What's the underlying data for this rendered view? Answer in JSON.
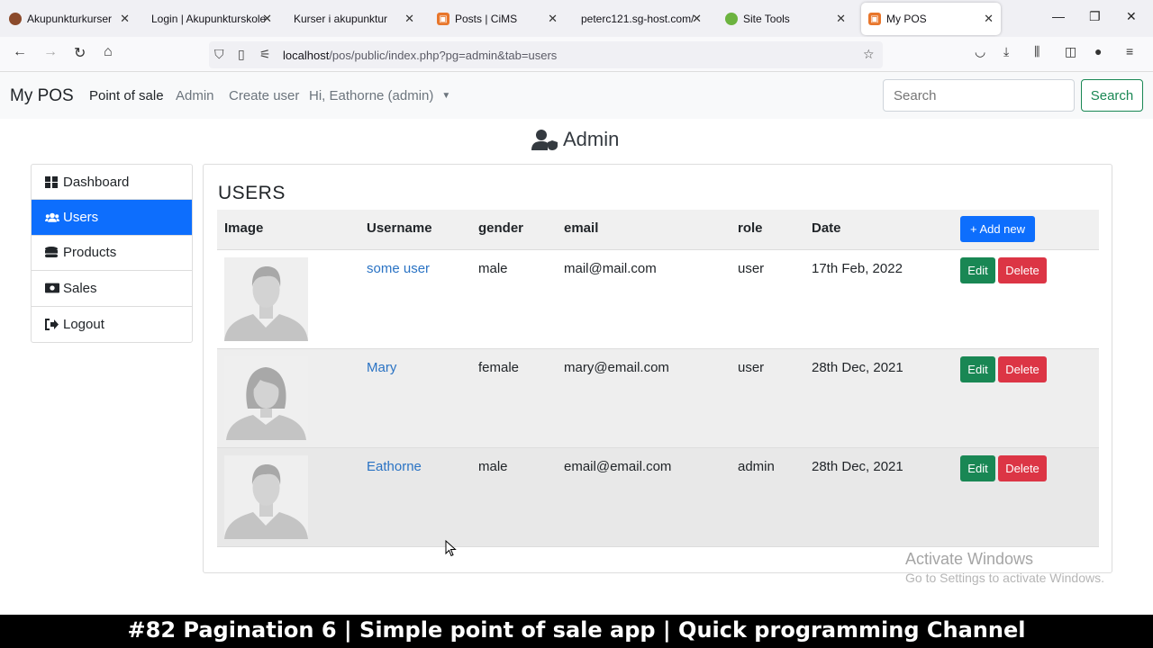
{
  "browser": {
    "tabs": [
      {
        "label": "Akupunkturkurser",
        "color": "#8b4a2b"
      },
      {
        "label": "Login | Akupunkturskole",
        "color": ""
      },
      {
        "label": "Kurser i akupunktur",
        "color": ""
      },
      {
        "label": "Posts | CiMS",
        "color": "#e8762b"
      },
      {
        "label": "peterc121.sg-host.com/",
        "color": ""
      },
      {
        "label": "Site Tools",
        "color": "#6cb33f"
      },
      {
        "label": "My POS",
        "color": "#e8762b"
      }
    ],
    "url_host": "localhost",
    "url_path": "/pos/public/index.php?pg=admin&tab=users"
  },
  "app": {
    "brand": "My POS",
    "nav": [
      "Point of sale",
      "Admin",
      "Create user",
      "Hi, Eathorne (admin)"
    ],
    "search_placeholder": "Search",
    "search_button": "Search"
  },
  "page_title": "Admin",
  "sidebar": {
    "items": [
      {
        "label": "Dashboard",
        "icon": "dashboard-icon"
      },
      {
        "label": "Users",
        "icon": "users-icon"
      },
      {
        "label": "Products",
        "icon": "database-icon"
      },
      {
        "label": "Sales",
        "icon": "money-icon"
      },
      {
        "label": "Logout",
        "icon": "logout-icon"
      }
    ],
    "active": "Users"
  },
  "users": {
    "heading": "USERS",
    "columns": [
      "Image",
      "Username",
      "gender",
      "email",
      "role",
      "Date"
    ],
    "add_label": "+ Add new",
    "edit_label": "Edit",
    "delete_label": "Delete",
    "rows": [
      {
        "username": "some user",
        "gender": "male",
        "email": "mail@mail.com",
        "role": "user",
        "date": "17th Feb, 2022"
      },
      {
        "username": "Mary",
        "gender": "female",
        "email": "mary@email.com",
        "role": "user",
        "date": "28th Dec, 2021"
      },
      {
        "username": "Eathorne",
        "gender": "male",
        "email": "email@email.com",
        "role": "admin",
        "date": "28th Dec, 2021"
      }
    ]
  },
  "watermark": {
    "line1": "Activate Windows",
    "line2": "Go to Settings to activate Windows."
  },
  "caption": "#82 Pagination 6 | Simple point of sale app | Quick programming Channel"
}
